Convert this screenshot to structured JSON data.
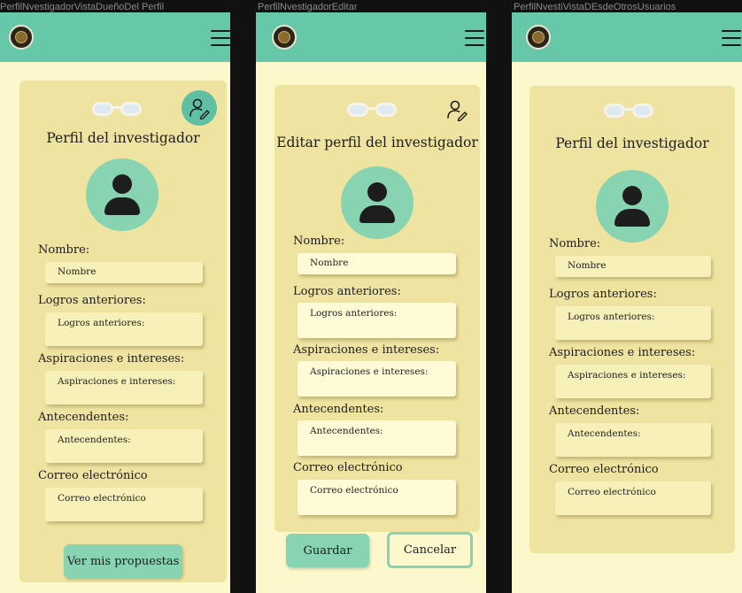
{
  "frames": [
    {
      "frame_label": "PerfilNvestigadorVistaDueñoDel Perfil",
      "title": "Perfil del investigador",
      "fields": [
        {
          "label": "Nombre:",
          "value": "Nombre"
        },
        {
          "label": "Logros anteriores:",
          "value": "Logros anteriores:"
        },
        {
          "label": "Aspiraciones e intereses:",
          "value": "Aspiraciones e intereses:"
        },
        {
          "label": "Antecendentes:",
          "value": "Antecendentes:"
        },
        {
          "label": "Correo electrónico",
          "value": "Correo electrónico"
        }
      ],
      "button_label": "Ver mis propuestas"
    },
    {
      "frame_label": "PerfilNvestigadorEditar",
      "title": "Editar perfil del investigador",
      "fields": [
        {
          "label": "Nombre:",
          "value": "Nombre"
        },
        {
          "label": "Logros anteriores:",
          "value": "Logros anteriores:"
        },
        {
          "label": "Aspiraciones e intereses:",
          "value": "Aspiraciones e intereses:"
        },
        {
          "label": "Antecendentes:",
          "value": "Antecendentes:"
        },
        {
          "label": "Correo electrónico",
          "value": "Correo electrónico"
        }
      ],
      "save_label": "Guardar",
      "cancel_label": "Cancelar"
    },
    {
      "frame_label": "PerfilNvestiVistaDEsdeOtrosUsuarios",
      "title": "Perfil del investigador",
      "fields": [
        {
          "label": "Nombre:",
          "value": "Nombre"
        },
        {
          "label": "Logros anteriores:",
          "value": "Logros anteriores:"
        },
        {
          "label": "Aspiraciones e intereses:",
          "value": "Aspiraciones e intereses:"
        },
        {
          "label": "Antecendentes:",
          "value": "Antecendentes:"
        },
        {
          "label": "Correo electrónico",
          "value": "Correo electrónico"
        }
      ]
    }
  ],
  "icons": {
    "logo": "logo-icon",
    "menu": "hamburger-menu-icon",
    "glasses": "glasses-icon",
    "avatar": "user-avatar-icon",
    "edit": "edit-profile-icon"
  },
  "colors": {
    "topbar": "#66c8a8",
    "screen_bg": "#fcf8cc",
    "card_bg": "#eee3a0",
    "accent": "#88d3b2",
    "field_bg": "#f7f0b8"
  }
}
